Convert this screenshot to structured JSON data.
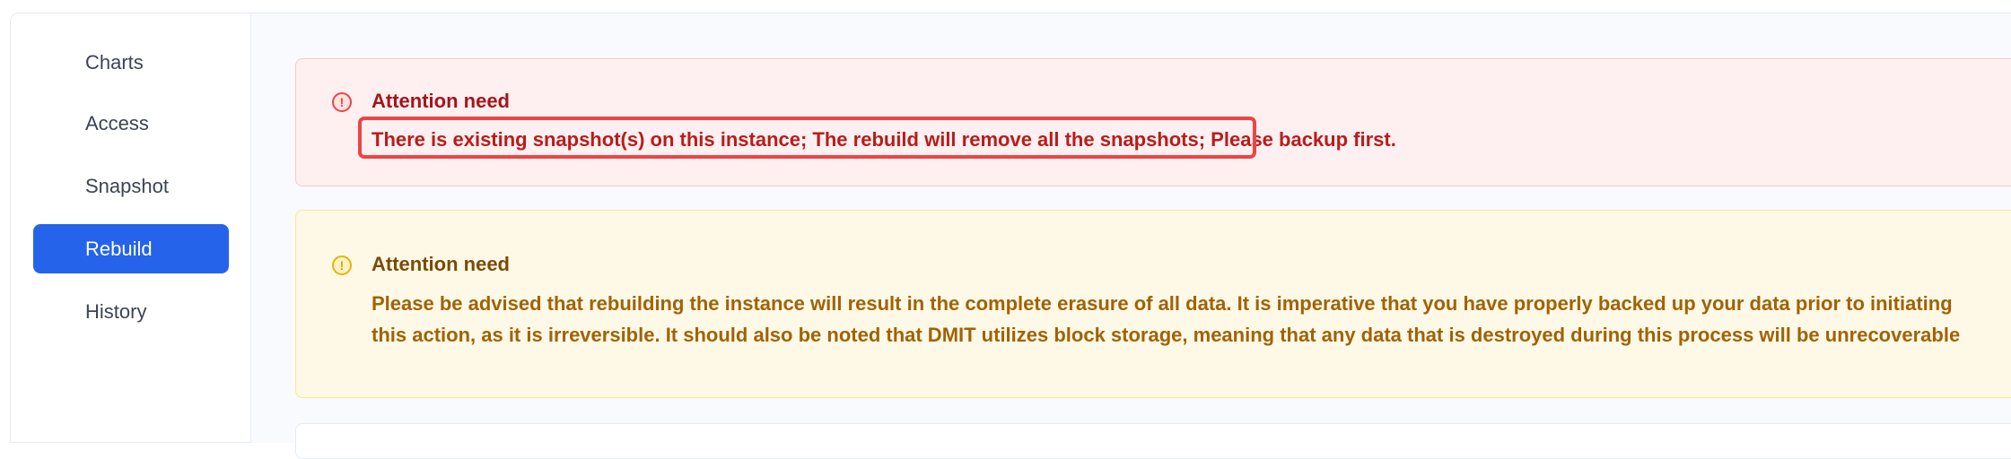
{
  "sidebar": {
    "items": [
      {
        "label": "Charts",
        "active": false
      },
      {
        "label": "Access",
        "active": false
      },
      {
        "label": "Snapshot",
        "active": false
      },
      {
        "label": "Rebuild",
        "active": true
      },
      {
        "label": "History",
        "active": false
      }
    ]
  },
  "alerts": [
    {
      "type": "error",
      "icon": "exclamation-circle-icon",
      "title": "Attention need",
      "text": "There is existing snapshot(s) on this instance; The rebuild will remove all the snapshots; Please backup first."
    },
    {
      "type": "warning",
      "icon": "exclamation-circle-icon",
      "title": "Attention need",
      "text": "Please be advised that rebuilding the instance will result in the complete erasure of all data. It is imperative that you have properly backed up your data prior to initiating this action, as it is irreversible. It should also be noted that DMIT utilizes block storage, meaning that any data that is destroyed during this process will be unrecoverable"
    }
  ],
  "colors": {
    "accent": "#2563eb",
    "error_text": "#b91c1c",
    "warning_text": "#a16207",
    "highlight": "#ef4444"
  }
}
